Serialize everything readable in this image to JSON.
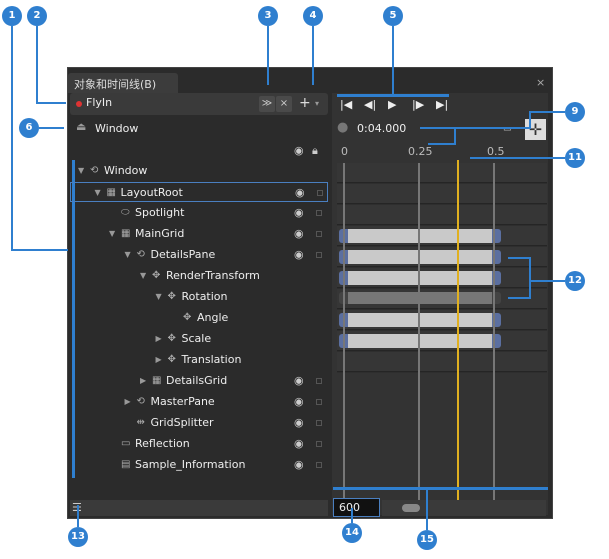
{
  "panel": {
    "tab": "对象和时间线(B)",
    "close": "×"
  },
  "storyboard": {
    "name": "FlyIn",
    "collapse": "≫",
    "close": "×",
    "add": "+",
    "menu": "▾"
  },
  "scope": {
    "label": "Window"
  },
  "tree": [
    {
      "label": "Window",
      "level": 0,
      "expand": "▼",
      "icon": "⟲",
      "eye": false
    },
    {
      "label": "LayoutRoot",
      "level": 1,
      "expand": "▼",
      "icon": "▦",
      "eye": true,
      "selected": true
    },
    {
      "label": "Spotlight",
      "level": 2,
      "expand": "",
      "icon": "⬭",
      "eye": true
    },
    {
      "label": "MainGrid",
      "level": 2,
      "expand": "▼",
      "icon": "▦",
      "eye": true
    },
    {
      "label": "DetailsPane",
      "level": 3,
      "expand": "▼",
      "icon": "⟲",
      "eye": true
    },
    {
      "label": "RenderTransform",
      "level": 4,
      "expand": "▼",
      "icon": "✥",
      "eye": false
    },
    {
      "label": "Rotation",
      "level": 5,
      "expand": "▼",
      "icon": "✥",
      "eye": false
    },
    {
      "label": "Angle",
      "level": 6,
      "expand": "",
      "icon": "✥",
      "eye": false
    },
    {
      "label": "Scale",
      "level": 5,
      "expand": "▶",
      "icon": "✥",
      "eye": false
    },
    {
      "label": "Translation",
      "level": 5,
      "expand": "▶",
      "icon": "✥",
      "eye": false
    },
    {
      "label": "DetailsGrid",
      "level": 4,
      "expand": "▶",
      "icon": "▦",
      "eye": true
    },
    {
      "label": "MasterPane",
      "level": 3,
      "expand": "▶",
      "icon": "⟲",
      "eye": true
    },
    {
      "label": "GridSplitter",
      "level": 3,
      "expand": "",
      "icon": "⇹",
      "eye": true
    },
    {
      "label": "Reflection",
      "level": 2,
      "expand": "",
      "icon": "▭",
      "eye": true
    },
    {
      "label": "Sample_Information",
      "level": 2,
      "expand": "",
      "icon": "▤",
      "eye": true
    }
  ],
  "timeline": {
    "time": "0:04.000",
    "ticks": [
      "0",
      "0.25",
      "0.5"
    ],
    "zoom": "600",
    "playhead": 0.38,
    "keyframe_rows": [
      4,
      5,
      6,
      7,
      8,
      9
    ],
    "controls": [
      "|◀",
      "◀|",
      "▶",
      "|▶",
      "▶|"
    ]
  },
  "callouts": [
    "1",
    "2",
    "3",
    "4",
    "5",
    "6",
    "9",
    "11",
    "12",
    "13",
    "14",
    "15"
  ],
  "colors": {
    "accent": "#2f7fcf",
    "playhead": "#e0b020"
  }
}
